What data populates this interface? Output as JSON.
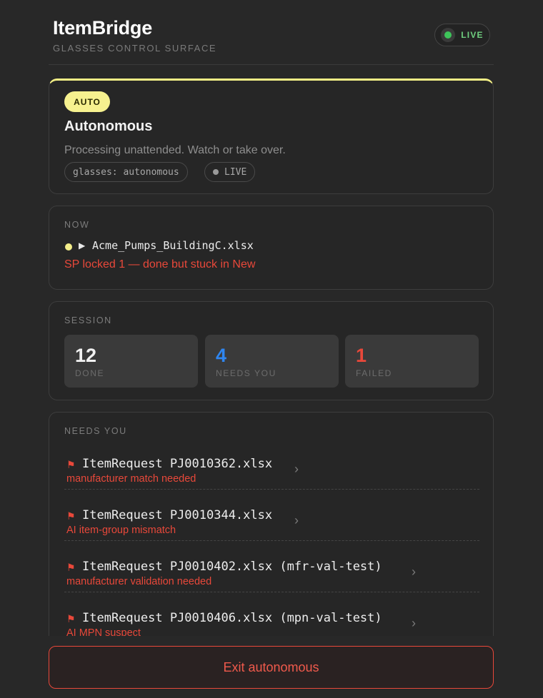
{
  "header": {
    "title": "ItemBridge",
    "subtitle": "GLASSES CONTROL SURFACE",
    "live_label": "LIVE"
  },
  "mode": {
    "badge": "AUTO",
    "title": "Autonomous",
    "description": "Processing unattended. Watch or take over.",
    "chips": {
      "glasses": "glasses: autonomous",
      "live": "LIVE"
    }
  },
  "now": {
    "label": "NOW",
    "play_glyph": "▶",
    "file": "Acme_Pumps_BuildingC.xlsx",
    "status": "SP locked 1 — done but stuck in New"
  },
  "session": {
    "label": "SESSION",
    "stats": [
      {
        "value": "12",
        "label": "DONE",
        "color": "#f2f2f2"
      },
      {
        "value": "4",
        "label": "NEEDS YOU",
        "color": "#2f86f0"
      },
      {
        "value": "1",
        "label": "FAILED",
        "color": "#e8483a"
      }
    ]
  },
  "needs_you": {
    "label": "NEEDS YOU",
    "items": [
      {
        "name": "ItemRequest PJ0010362.xlsx",
        "reason": "manufacturer match needed"
      },
      {
        "name": "ItemRequest PJ0010344.xlsx",
        "reason": "AI item-group mismatch"
      },
      {
        "name": "ItemRequest PJ0010402.xlsx (mfr-val-test)",
        "reason": "manufacturer validation needed"
      },
      {
        "name": "ItemRequest PJ0010406.xlsx (mpn-val-test)",
        "reason": "AI MPN suspect"
      }
    ]
  },
  "icons": {
    "flag": "⚑",
    "chevron": "›"
  },
  "actions": {
    "exit_label": "Exit autonomous"
  },
  "colors": {
    "accent_yellow": "#f6f18f",
    "danger": "#e8483a",
    "live_green": "#3ec45a",
    "info_blue": "#2f86f0"
  }
}
